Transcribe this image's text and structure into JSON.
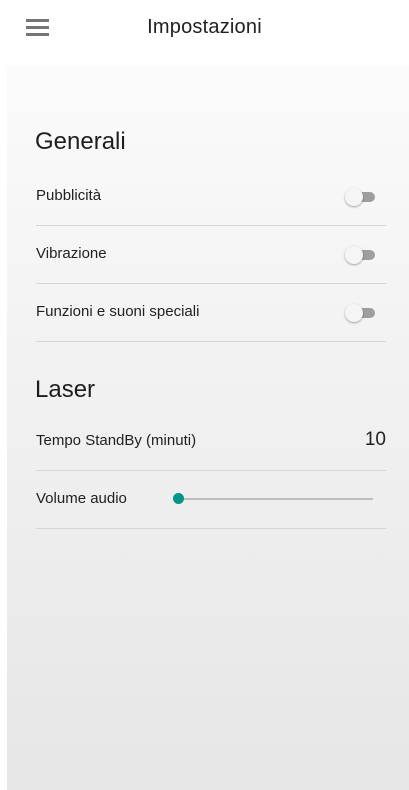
{
  "header": {
    "title": "Impostazioni",
    "menu_icon": "hamburger-menu-icon"
  },
  "sections": {
    "general": {
      "title": "Generali",
      "items": [
        {
          "label": "Pubblicità",
          "enabled": false
        },
        {
          "label": "Vibrazione",
          "enabled": false
        },
        {
          "label": "Funzioni e suoni speciali",
          "enabled": false
        }
      ]
    },
    "laser": {
      "title": "Laser",
      "standby": {
        "label": "Tempo StandBy (minuti)",
        "value": "10"
      },
      "volume": {
        "label": "Volume audio",
        "level": 0
      }
    }
  },
  "colors": {
    "accent": "#009688",
    "toggle_off_track": "#9e9e9e",
    "toggle_off_knob": "#f5f5f5",
    "divider": "#d6d6d6"
  }
}
